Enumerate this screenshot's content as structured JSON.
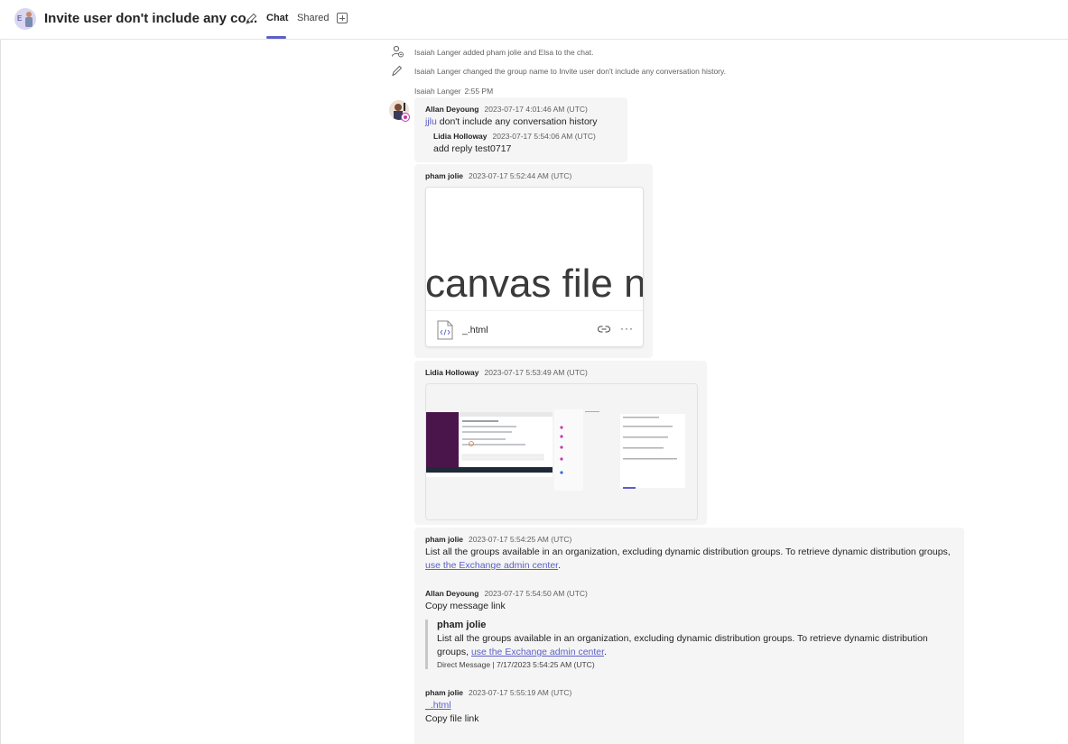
{
  "header": {
    "avatar_letter": "E",
    "title": "Invite user don't include any co...",
    "tabs": [
      {
        "label": "Chat",
        "active": true
      },
      {
        "label": "Shared",
        "active": false
      }
    ]
  },
  "events": [
    {
      "icon": "person-add-icon",
      "text": "Isaiah Langer added pham jolie and Elsa to the chat."
    },
    {
      "icon": "pencil-icon",
      "text": "Isaiah Langer changed the group name to Invite user don't include any conversation history."
    }
  ],
  "sender_line": {
    "name": "Isaiah Langer",
    "time": "2:55 PM"
  },
  "messages": [
    {
      "author": "Allan Deyoung",
      "time": "2023-07-17 4:01:46 AM (UTC)",
      "mention": "jjlu",
      "text": " don't include any conversation history",
      "reply": {
        "author": "Lidia Holloway",
        "time": "2023-07-17 5:54:06 AM (UTC)",
        "text": "add reply test0717"
      }
    },
    {
      "author": "pham jolie",
      "time": "2023-07-17 5:52:44 AM (UTC)",
      "file": {
        "preview_text": "canvas file n",
        "name": "_.html"
      }
    },
    {
      "author": "Lidia Holloway",
      "time": "2023-07-17 5:53:49 AM (UTC)"
    },
    {
      "author": "pham jolie",
      "time": "2023-07-17 5:54:25 AM (UTC)",
      "text": "List all the groups available in an organization, excluding dynamic distribution groups. To retrieve dynamic distribution groups,",
      "link": "use the Exchange admin center",
      "after_link": "."
    },
    {
      "author": "Allan Deyoung",
      "time": "2023-07-17 5:54:50 AM (UTC)",
      "text": "Copy message link",
      "quote": {
        "author": "pham jolie",
        "text_line1": "List all the groups available in an organization, excluding dynamic distribution groups. To retrieve dynamic distribution",
        "text_line2": "groups, ",
        "link": "use the Exchange admin center",
        "after_link": ".",
        "meta": "Direct Message | 7/17/2023 5:54:25 AM (UTC)"
      }
    },
    {
      "author": "pham jolie",
      "time": "2023-07-17 5:55:19 AM (UTC)",
      "link": "_.html",
      "text": "Copy file link"
    }
  ],
  "colors": {
    "accent": "#5b5fc7",
    "bubble": "#f5f5f5",
    "muted": "#616161"
  }
}
